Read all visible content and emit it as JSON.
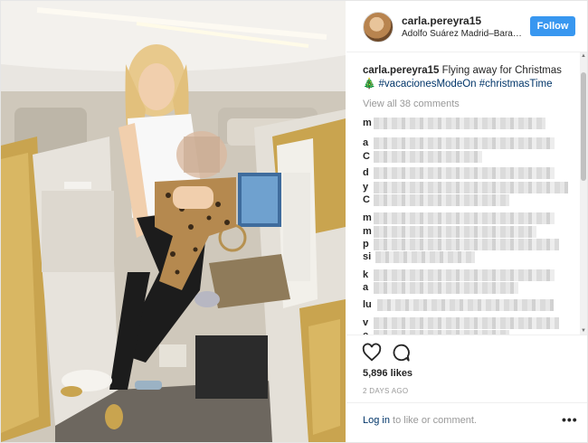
{
  "post": {
    "image_alt": "Woman holding child in airplane first-class suite"
  },
  "header": {
    "username": "carla.pereyra15",
    "location": "Adolfo Suárez Madrid–Bara…",
    "follow_label": "Follow"
  },
  "caption": {
    "username": "carla.pereyra15",
    "text": " Flying away for Christmas ",
    "emoji": "🎄",
    "tags": [
      "#vacacionesModeOn",
      "#christmasTime"
    ]
  },
  "view_all_comments": "View all 38 comments",
  "comments": [
    {
      "initial": "m"
    },
    {
      "initial": "a"
    },
    {
      "initial": "C"
    },
    {
      "initial": "d"
    },
    {
      "initial": "y"
    },
    {
      "initial": "C"
    },
    {
      "initial": "m"
    },
    {
      "initial": "m"
    },
    {
      "initial": "p"
    },
    {
      "initial": "si"
    },
    {
      "initial": "k"
    },
    {
      "initial": "a"
    },
    {
      "initial": "lu"
    },
    {
      "initial": "v"
    },
    {
      "initial": "c"
    }
  ],
  "likes": "5,896 likes",
  "timestamp": "2 DAYS AGO",
  "login": {
    "link": "Log in",
    "rest": " to like or comment."
  },
  "more_icon": "ellipsis-icon",
  "colors": {
    "follow_bg": "#3897f0",
    "link": "#003569",
    "muted": "#999999"
  }
}
